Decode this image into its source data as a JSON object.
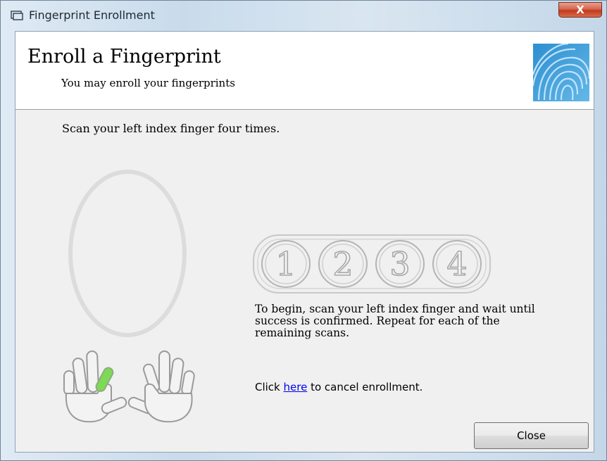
{
  "window": {
    "title": "Fingerprint Enrollment",
    "close_label": "X"
  },
  "header": {
    "title": "Enroll a Fingerprint",
    "subtitle": "You may enroll your fingerprints",
    "logo_icon": "fingerprint-icon"
  },
  "instruction": "Scan your left index finger four times.",
  "steps": [
    "1",
    "2",
    "3",
    "4"
  ],
  "help": {
    "text": "To begin, scan your left index finger and wait until success is confirmed. Repeat for each of the remaining scans."
  },
  "cancel": {
    "prefix": "Click ",
    "link": "here",
    "suffix": " to cancel enrollment."
  },
  "buttons": {
    "close": "Close"
  },
  "colors": {
    "selected_finger": "#7ed957",
    "close_button_red": "#c23a1d",
    "link": "#0000ee"
  }
}
